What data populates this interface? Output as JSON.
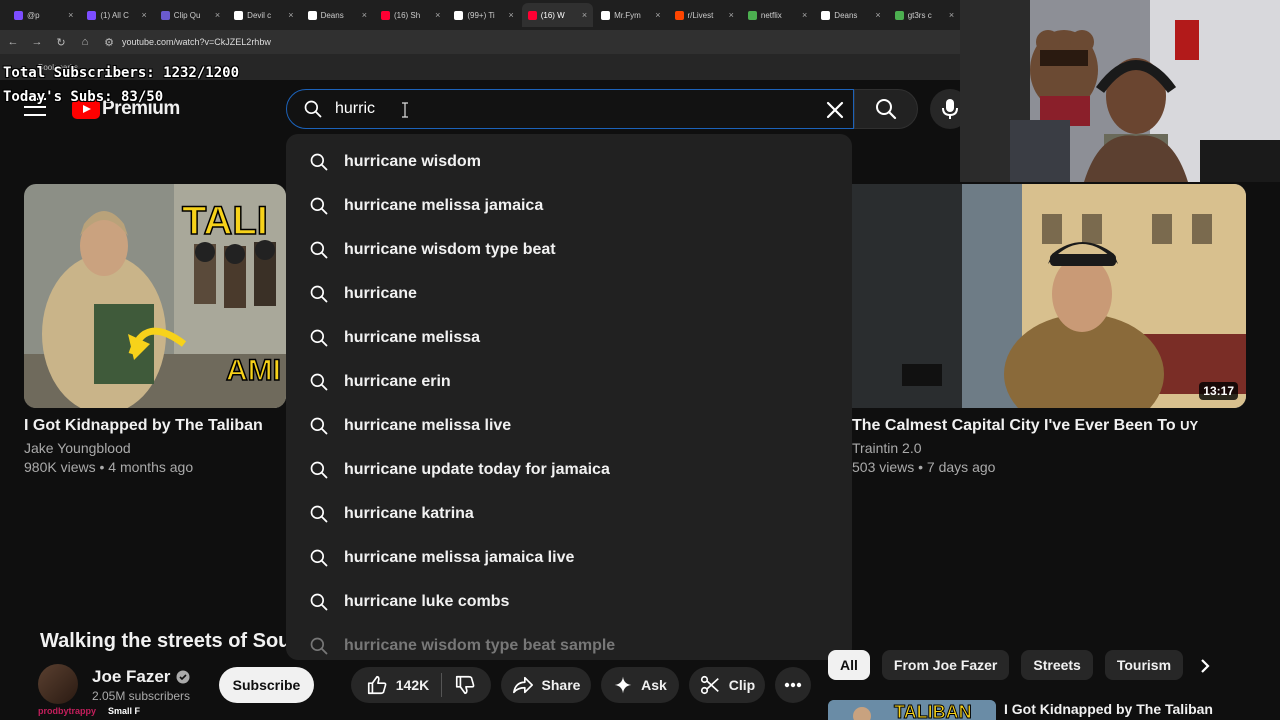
{
  "browser": {
    "tabs": [
      {
        "label": "@p",
        "color": "#7c4dff",
        "active": false
      },
      {
        "label": "(1) All C",
        "color": "#7c4dff",
        "active": false
      },
      {
        "label": "Clip Qu",
        "color": "#6a5acd",
        "active": false
      },
      {
        "label": "Devil c",
        "color": "#ffffff",
        "active": false
      },
      {
        "label": "Deans",
        "color": "#ffffff",
        "active": false
      },
      {
        "label": "(16) Sh",
        "color": "#ff0033",
        "active": false
      },
      {
        "label": "(99+) Ti",
        "color": "#ffffff",
        "active": false
      },
      {
        "label": "(16) W",
        "color": "#ff0033",
        "active": true
      },
      {
        "label": "Mr.Fym",
        "color": "#ffffff",
        "active": false
      },
      {
        "label": "r/Livest",
        "color": "#ff4500",
        "active": false
      },
      {
        "label": "netflix",
        "color": "#4caf50",
        "active": false
      },
      {
        "label": "Deans",
        "color": "#ffffff",
        "active": false
      },
      {
        "label": "gt3rs c",
        "color": "#4caf50",
        "active": false
      }
    ],
    "url": "youtube.com/watch?v=CkJZEL2rhbw",
    "bookmarks_label": "Bookmarks"
  },
  "overlay": {
    "total_subscribers": "Total Subscribers: 1232/1200",
    "todays_subs": "Today's Subs: 83/50"
  },
  "header": {
    "logo_text": "Premium",
    "search_value": "hurric"
  },
  "suggestions": [
    "hurricane wisdom",
    "hurricane melissa jamaica",
    "hurricane wisdom type beat",
    "hurricane",
    "hurricane melissa",
    "hurricane erin",
    "hurricane melissa live",
    "hurricane update today for jamaica",
    "hurricane katrina",
    "hurricane melissa jamaica live",
    "hurricane luke combs",
    "hurricane wisdom type beat sample"
  ],
  "cards": {
    "left": {
      "title": "I Got Kidnapped by The Taliban",
      "channel": "Jake Youngblood",
      "meta": "980K views • 4 months ago",
      "thumb_text_top": "TALI",
      "thumb_text_bottom": "AMI"
    },
    "right": {
      "title": "The Calmest Capital City I've Ever Been To",
      "title_suffix": "UY",
      "channel": "Traintin 2.0",
      "meta": "503 views • 7 days ago",
      "duration": "13:17"
    }
  },
  "player": {
    "title": "Walking the streets of South",
    "channel_name": "Joe Fazer",
    "subscribers": "2.05M subscribers",
    "subscribe_label": "Subscribe",
    "likes": "142K",
    "share_label": "Share",
    "ask_label": "Ask",
    "clip_label": "Clip"
  },
  "chips": [
    "All",
    "From Joe Fazer",
    "Streets",
    "Tourism"
  ],
  "related": {
    "title": "I Got Kidnapped by The Taliban",
    "thumb_text": "TALIBAN"
  },
  "chat": {
    "user": "prodbytrappy",
    "message": "Small F"
  }
}
